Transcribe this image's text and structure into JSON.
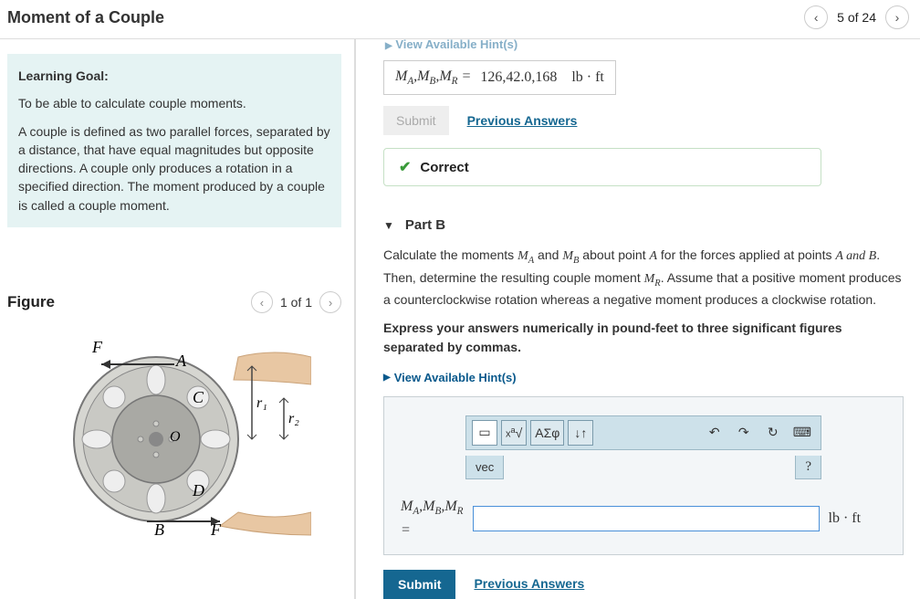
{
  "header": {
    "title": "Moment of a Couple",
    "pagination": "5 of 24"
  },
  "learning": {
    "title": "Learning Goal:",
    "line1": "To be able to calculate couple moments.",
    "line2": "A couple is defined as two parallel forces, separated by a distance, that have equal magnitudes but opposite directions. A couple only produces a rotation in a specified direction. The moment produced by a couple is called a couple moment."
  },
  "figure": {
    "title": "Figure",
    "pagination": "1 of 1",
    "labels": {
      "F_top": "F",
      "A": "A",
      "C": "C",
      "O": "O",
      "D": "D",
      "B": "B",
      "F_bot": "F",
      "r1": "r₁",
      "r2": "r₂"
    }
  },
  "partA": {
    "hints_link": "View Available Hint(s)",
    "formula_label": "M_A, M_B, M_R =",
    "formula_value": "126,42.0,168",
    "units": "lb · ft",
    "submit": "Submit",
    "previous": "Previous Answers",
    "correct": "Correct"
  },
  "partB": {
    "header": "Part B",
    "p1_prefix": "Calculate the moments ",
    "p1_mid1": " and ",
    "p1_mid2": " about point ",
    "p1_A": "A",
    "p1_mid3": " for the forces applied at points ",
    "p1_AB": "A and B",
    "p1_mid4": ". Then, determine the resulting couple moment ",
    "p1_end": ". Assume that a positive moment produces a counterclockwise rotation whereas a negative moment produces a clockwise rotation.",
    "p2": "Express your answers numerically in pound-feet to three significant figures separated by commas.",
    "hints_link": "View Available Hint(s)",
    "toolbar": {
      "templates_label": "▢√▢",
      "greek_label": "ΑΣφ",
      "arrows_label": "↓↑",
      "vec_label": "vec",
      "help_label": "?"
    },
    "eq_label": "M_A, M_B, M_R =",
    "units": "lb · ft",
    "submit": "Submit",
    "previous": "Previous Answers"
  }
}
